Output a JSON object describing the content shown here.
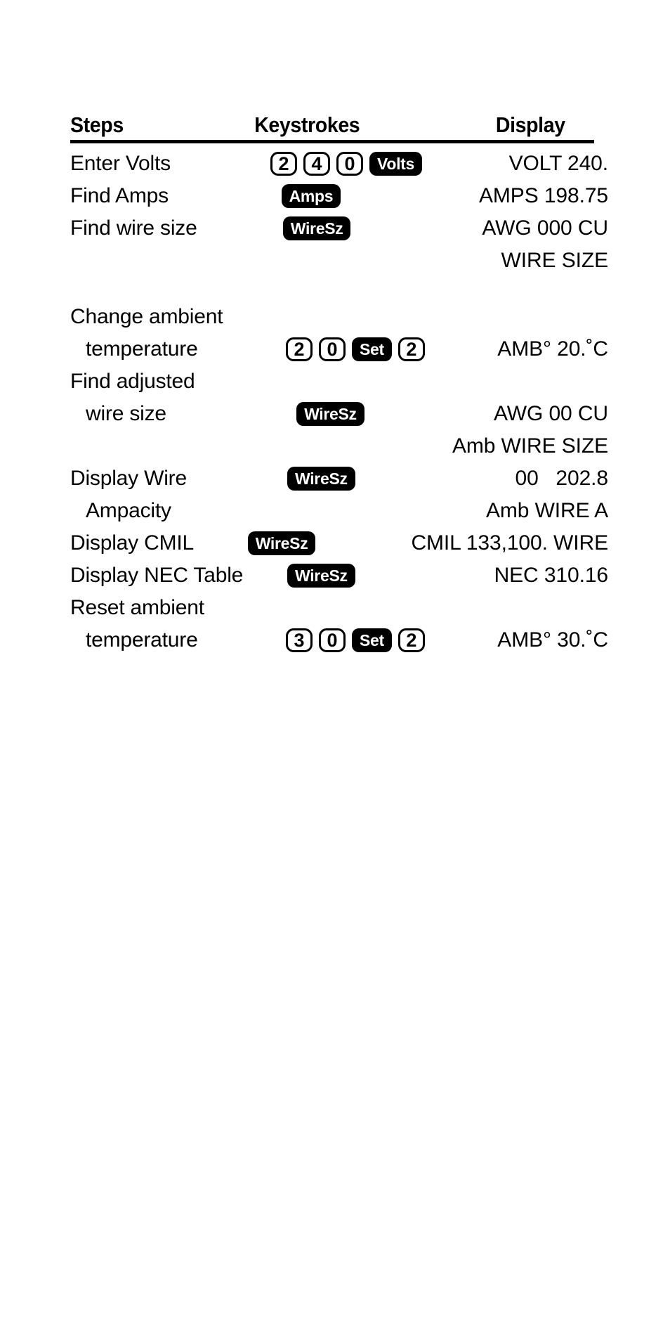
{
  "table": {
    "headers": {
      "steps": "Steps",
      "keystrokes": "Keystrokes",
      "display": "Display"
    },
    "rows": [
      {
        "step": "Enter Volts",
        "keys": [
          {
            "type": "num",
            "label": "2"
          },
          {
            "type": "num",
            "label": "4"
          },
          {
            "type": "num",
            "label": "0"
          },
          {
            "type": "fn",
            "label": "Volts"
          }
        ],
        "display": "VOLT 240."
      },
      {
        "step": "Find Amps",
        "keys": [
          {
            "type": "fn",
            "label": "Amps"
          }
        ],
        "display": "AMPS 198.75"
      },
      {
        "step": "Find wire size",
        "keys": [
          {
            "type": "fn",
            "label": "WireSz"
          }
        ],
        "display": "AWG 000 CU"
      },
      {
        "step": "",
        "keys": [],
        "display": "WIRE SIZE"
      },
      {
        "step": "Change ambient",
        "keys": [],
        "display": ""
      },
      {
        "step": "temperature",
        "indent": true,
        "keys": [
          {
            "type": "num",
            "label": "2"
          },
          {
            "type": "num",
            "label": "0"
          },
          {
            "type": "fn",
            "label": "Set"
          },
          {
            "type": "num",
            "label": "2"
          }
        ],
        "display": "AMB° 20.˚C"
      },
      {
        "step": "Find adjusted",
        "keys": [],
        "display": ""
      },
      {
        "step": "wire size",
        "indent": true,
        "keys": [
          {
            "type": "fn",
            "label": "WireSz"
          }
        ],
        "display": "AWG 00 CU"
      },
      {
        "step": "",
        "keys": [],
        "display": "Amb WIRE SIZE"
      },
      {
        "step": "Display Wire",
        "keys": [
          {
            "type": "fn",
            "label": "WireSz"
          }
        ],
        "display": "00   202.8"
      },
      {
        "step": "Ampacity",
        "indent": true,
        "keys": [],
        "display": "Amb WIRE A"
      },
      {
        "step": "Display CMIL",
        "keys": [
          {
            "type": "fn",
            "label": "WireSz"
          }
        ],
        "display": "CMIL 133,100. WIRE"
      },
      {
        "step": "Display NEC Table",
        "keys": [
          {
            "type": "fn",
            "label": "WireSz"
          }
        ],
        "display": "NEC 310.16"
      },
      {
        "step": "Reset ambient",
        "keys": [],
        "display": ""
      },
      {
        "step": "temperature",
        "indent": true,
        "keys": [
          {
            "type": "num",
            "label": "3"
          },
          {
            "type": "num",
            "label": "0"
          },
          {
            "type": "fn",
            "label": "Set"
          },
          {
            "type": "num",
            "label": "2"
          }
        ],
        "display": "AMB° 30.˚C"
      }
    ]
  },
  "colors": {
    "ink": "#000000",
    "paper": "#ffffff",
    "key_fill": "#000000",
    "key_text": "#ffffff"
  }
}
